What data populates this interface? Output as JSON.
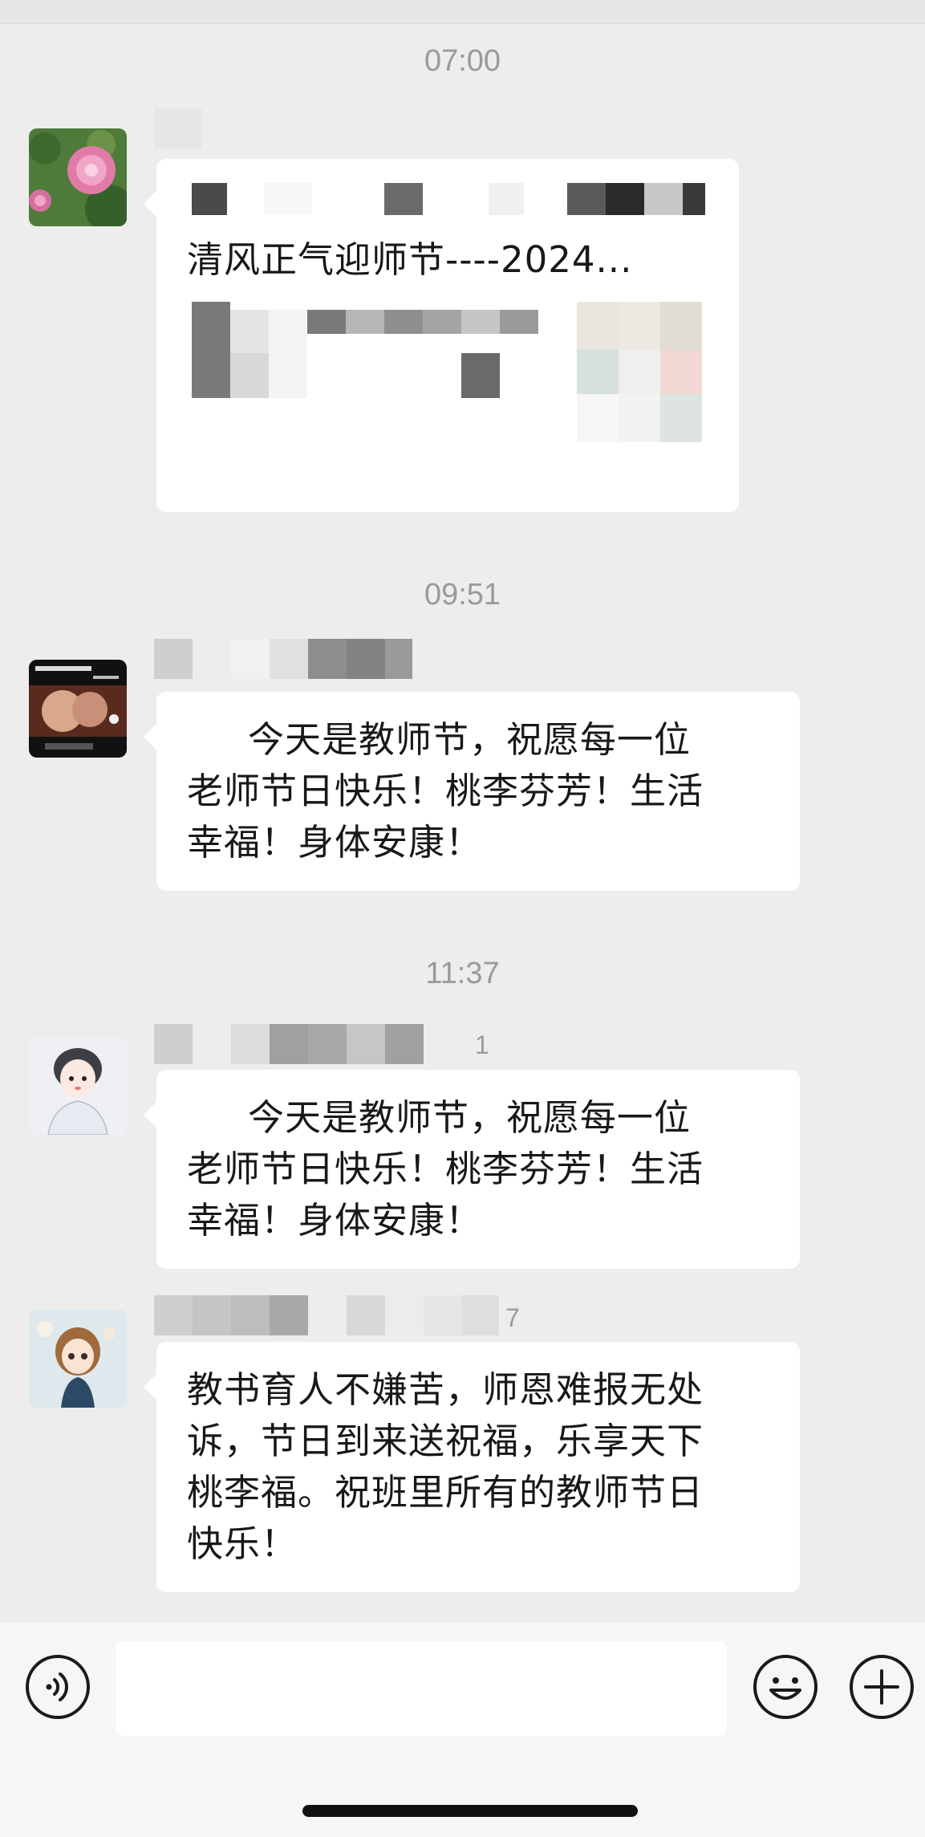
{
  "timestamps": [
    "07:00",
    "09:51",
    "11:37"
  ],
  "messages": [
    {
      "type": "card",
      "card_title": "清风正气迎师节----2024..."
    },
    {
      "type": "text",
      "sender_suffix": "",
      "text_lines": [
        "今天是教师节，祝愿每一位",
        "老师节日快乐！桃李芬芳！生活",
        "幸福！身体安康！"
      ]
    },
    {
      "type": "text",
      "sender_suffix": "1",
      "text_lines": [
        "今天是教师节，祝愿每一位",
        "老师节日快乐！桃李芬芳！生活",
        "幸福！身体安康！"
      ]
    },
    {
      "type": "text",
      "sender_suffix": "7",
      "text_lines": [
        "教书育人不嫌苦，师恩难报无处",
        "诉，节日到来送祝福，乐享天下",
        "桃李福。祝班里所有的教师节日",
        "快乐！"
      ]
    }
  ],
  "input": {
    "value": "",
    "placeholder": ""
  },
  "icons": {
    "voice": "voice-icon",
    "emoji": "emoji-icon",
    "more": "plus-icon"
  },
  "colors": {
    "background": "#ededed",
    "bubble": "#ffffff",
    "timestamp": "#9a9a9a"
  }
}
